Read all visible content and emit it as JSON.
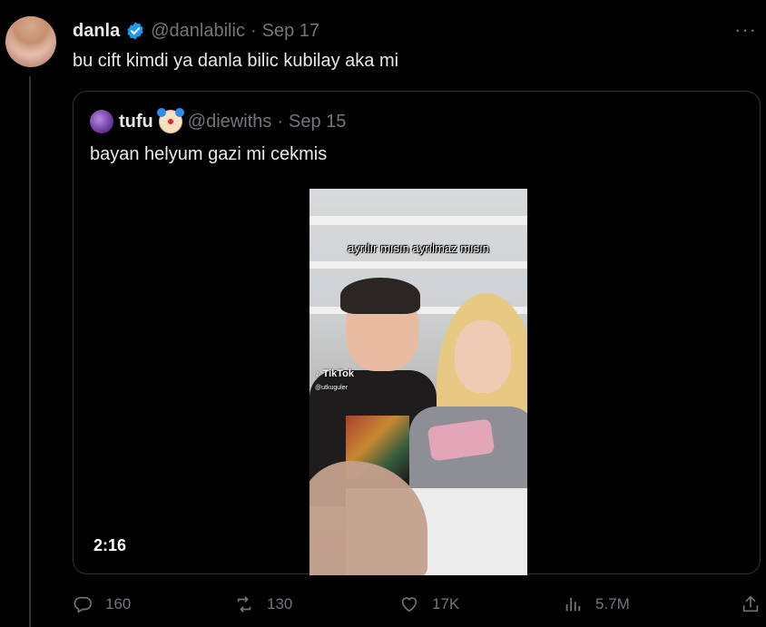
{
  "tweet": {
    "author_name": "danla",
    "author_handle": "@danlabilic",
    "separator": "·",
    "date": "Sep 17",
    "text": "bu cift kimdi ya danla bilic kubilay aka mi",
    "more_label": "···"
  },
  "quoted": {
    "author_name": "tufu",
    "author_handle": "@diewiths",
    "separator": "·",
    "date": "Sep 15",
    "text": "bayan helyum gazi mi cekmis",
    "video": {
      "caption": "ayrılır mısın ayrılmaz mısın",
      "watermark": "TikTok",
      "watermark_user": "@utkuguler",
      "duration": "2:16"
    }
  },
  "actions": {
    "replies": "160",
    "retweets": "130",
    "likes": "17K",
    "views": "5.7M"
  },
  "colors": {
    "background": "#000000",
    "text": "#e7e9ea",
    "muted": "#71767b",
    "border": "#2f3336",
    "verified": "#1d9bf0"
  }
}
